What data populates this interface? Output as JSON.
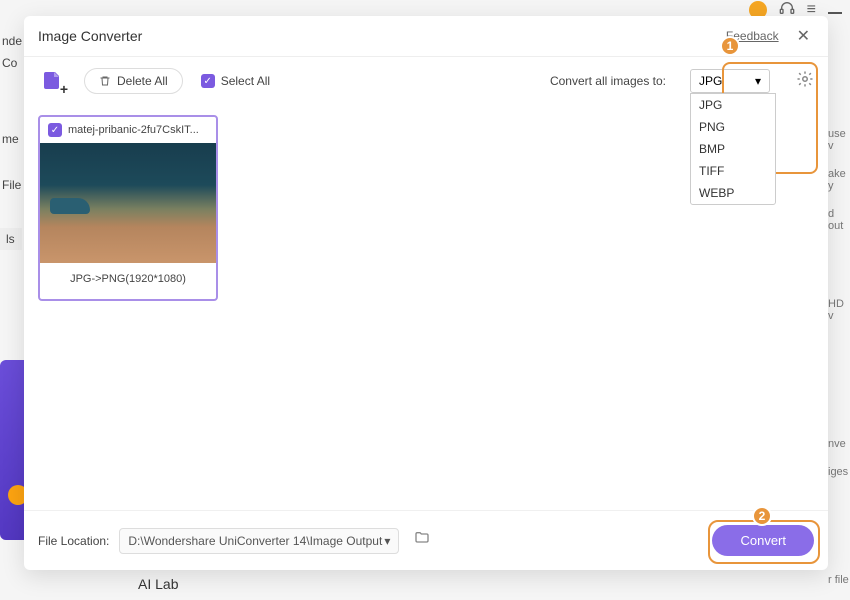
{
  "bg": {
    "left_items": [
      "nde",
      "Co",
      "me",
      "File",
      "ls"
    ],
    "right_items": [
      "use v",
      "ake y",
      "d out",
      "HD v",
      "nve",
      "iges",
      "r file"
    ]
  },
  "dialog": {
    "title": "Image Converter",
    "feedback": "Feedback"
  },
  "toolbar": {
    "delete_all": "Delete All",
    "select_all": "Select All",
    "convert_label": "Convert all images to:",
    "selected_format": "JPG",
    "formats": [
      "JPG",
      "PNG",
      "BMP",
      "TIFF",
      "WEBP"
    ]
  },
  "thumbnail": {
    "filename": "matej-pribanic-2fu7CskIT...",
    "caption": "JPG->PNG(1920*1080)"
  },
  "footer": {
    "location_label": "File Location:",
    "location_path": "D:\\Wondershare UniConverter 14\\Image Output",
    "convert": "Convert"
  },
  "callouts": {
    "badge1": "1",
    "badge2": "2"
  },
  "ailab": "AI Lab"
}
